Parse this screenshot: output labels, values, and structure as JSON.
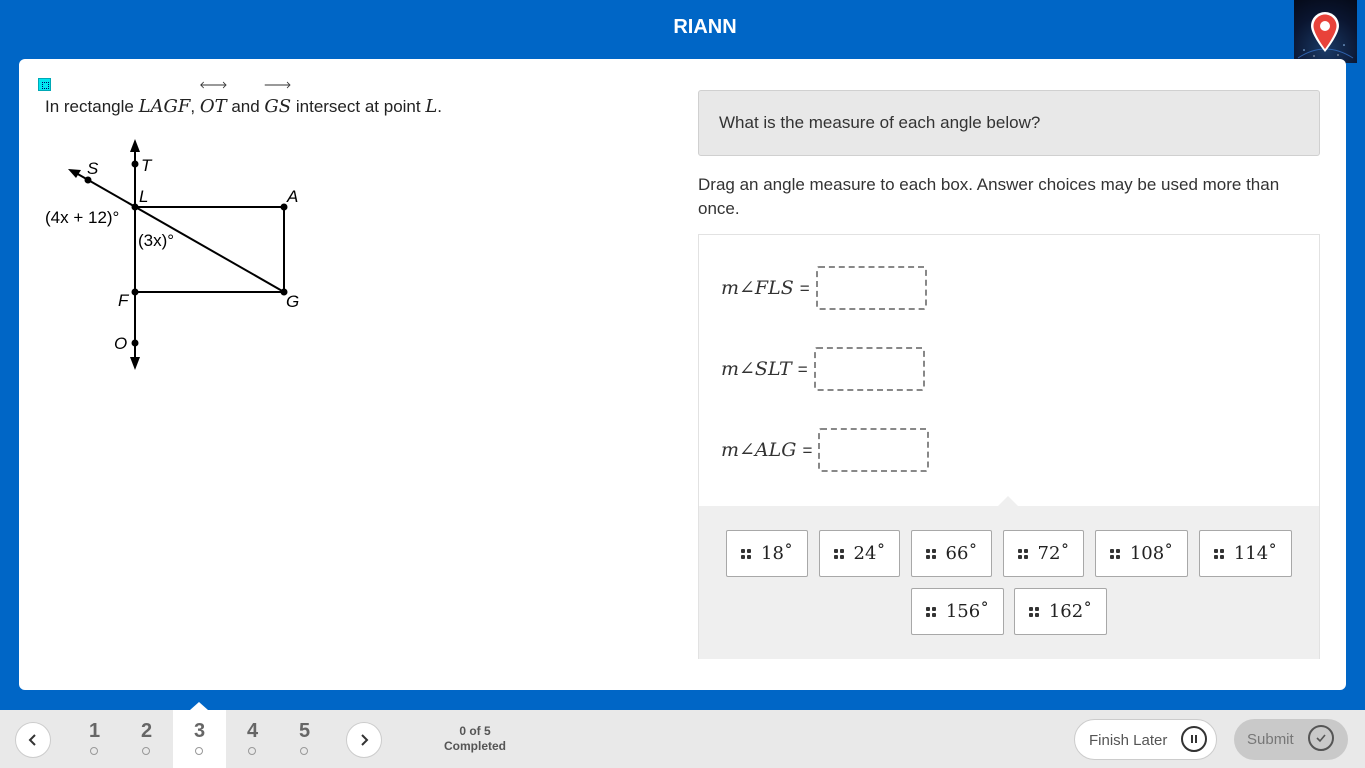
{
  "header": {
    "title": "RIANN",
    "logo_icon": "map-pin-icon"
  },
  "question": {
    "stem": {
      "prefix": "In rectangle ",
      "rect_name": "LAGF",
      "comma": ", ",
      "line1": "OT",
      "and": " and ",
      "ray1": "GS",
      "suffix": " intersect at point ",
      "point": "L",
      "period": "."
    },
    "figure": {
      "labels": {
        "S": "S",
        "T": "T",
        "L": "L",
        "A": "A",
        "F": "F",
        "G": "G",
        "O": "O"
      },
      "angle1": "(4x + 12)°",
      "angle2": "(3x)°"
    }
  },
  "prompt": "What is the measure of each angle below?",
  "instructions": "Drag an angle measure to each box. Answer choices may be used more than once.",
  "equations": [
    {
      "label": "m∠FLS",
      "eq": "="
    },
    {
      "label": "m∠SLT",
      "eq": "="
    },
    {
      "label": "m∠ALG",
      "eq": "="
    }
  ],
  "choices": [
    "18˚",
    "24˚",
    "66˚",
    "72˚",
    "108˚",
    "114˚",
    "156˚",
    "162˚"
  ],
  "footer": {
    "questions": [
      "1",
      "2",
      "3",
      "4",
      "5"
    ],
    "current": "3",
    "progress_line1": "0 of 5",
    "progress_line2": "Completed",
    "finish_later": "Finish Later",
    "submit": "Submit"
  },
  "colors": {
    "brand": "#0066c6",
    "flag": "#00e5f0",
    "tray": "#efefef"
  }
}
